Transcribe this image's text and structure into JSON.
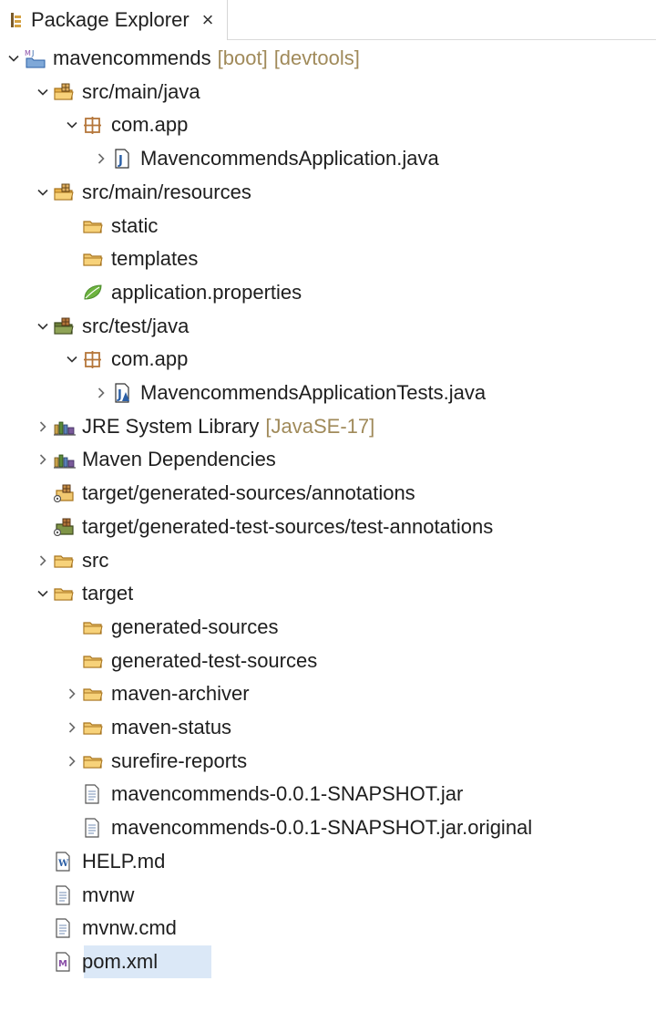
{
  "view": {
    "tab_title": "Package Explorer",
    "close_glyph": "×"
  },
  "tree": [
    {
      "label": "mavencommends",
      "decorations": [
        "[boot]",
        "[devtools]"
      ],
      "icon": "maven-project-icon",
      "depth": 0,
      "twisty": "expanded"
    },
    {
      "label": "src/main/java",
      "icon": "source-folder-icon",
      "depth": 1,
      "twisty": "expanded"
    },
    {
      "label": "com.app",
      "icon": "package-icon",
      "depth": 2,
      "twisty": "expanded"
    },
    {
      "label": "MavencommendsApplication.java",
      "icon": "java-file-icon",
      "depth": 3,
      "twisty": "collapsed"
    },
    {
      "label": "src/main/resources",
      "icon": "source-folder-icon",
      "depth": 1,
      "twisty": "expanded"
    },
    {
      "label": "static",
      "icon": "folder-icon",
      "depth": 2,
      "twisty": "none"
    },
    {
      "label": "templates",
      "icon": "folder-icon",
      "depth": 2,
      "twisty": "none"
    },
    {
      "label": "application.properties",
      "icon": "spring-leaf-icon",
      "depth": 2,
      "twisty": "none"
    },
    {
      "label": "src/test/java",
      "icon": "test-source-folder-icon",
      "depth": 1,
      "twisty": "expanded"
    },
    {
      "label": "com.app",
      "icon": "package-icon",
      "depth": 2,
      "twisty": "expanded"
    },
    {
      "label": "MavencommendsApplicationTests.java",
      "icon": "java-test-file-icon",
      "depth": 3,
      "twisty": "collapsed"
    },
    {
      "label": "JRE System Library",
      "decorations": [
        "[JavaSE-17]"
      ],
      "icon": "library-icon",
      "depth": 1,
      "twisty": "collapsed"
    },
    {
      "label": "Maven Dependencies",
      "icon": "library-icon",
      "depth": 1,
      "twisty": "collapsed"
    },
    {
      "label": "target/generated-sources/annotations",
      "icon": "generated-source-folder-icon",
      "depth": 1,
      "twisty": "none"
    },
    {
      "label": "target/generated-test-sources/test-annotations",
      "icon": "generated-test-source-folder-icon",
      "depth": 1,
      "twisty": "none"
    },
    {
      "label": "src",
      "icon": "folder-icon",
      "depth": 1,
      "twisty": "collapsed"
    },
    {
      "label": "target",
      "icon": "folder-icon",
      "depth": 1,
      "twisty": "expanded"
    },
    {
      "label": "generated-sources",
      "icon": "folder-icon",
      "depth": 2,
      "twisty": "none"
    },
    {
      "label": "generated-test-sources",
      "icon": "folder-icon",
      "depth": 2,
      "twisty": "none"
    },
    {
      "label": "maven-archiver",
      "icon": "folder-icon",
      "depth": 2,
      "twisty": "collapsed"
    },
    {
      "label": "maven-status",
      "icon": "folder-icon",
      "depth": 2,
      "twisty": "collapsed"
    },
    {
      "label": "surefire-reports",
      "icon": "folder-icon",
      "depth": 2,
      "twisty": "collapsed"
    },
    {
      "label": "mavencommends-0.0.1-SNAPSHOT.jar",
      "icon": "text-file-icon",
      "depth": 2,
      "twisty": "none"
    },
    {
      "label": "mavencommends-0.0.1-SNAPSHOT.jar.original",
      "icon": "text-file-icon",
      "depth": 2,
      "twisty": "none"
    },
    {
      "label": "HELP.md",
      "icon": "markdown-file-icon",
      "depth": 1,
      "twisty": "none"
    },
    {
      "label": "mvnw",
      "icon": "text-file-icon",
      "depth": 1,
      "twisty": "none"
    },
    {
      "label": "mvnw.cmd",
      "icon": "text-file-icon",
      "depth": 1,
      "twisty": "none"
    },
    {
      "label": "pom.xml",
      "icon": "maven-pom-icon",
      "depth": 1,
      "twisty": "none",
      "selected": true
    }
  ],
  "colors": {
    "selection": "#dbe8f7",
    "decoration": "#a08a5a",
    "folder": "#e8b24a",
    "package": "#b5763a",
    "spring": "#6db33f",
    "java_blue": "#2b5fa6",
    "library": "#5a7fb6"
  }
}
